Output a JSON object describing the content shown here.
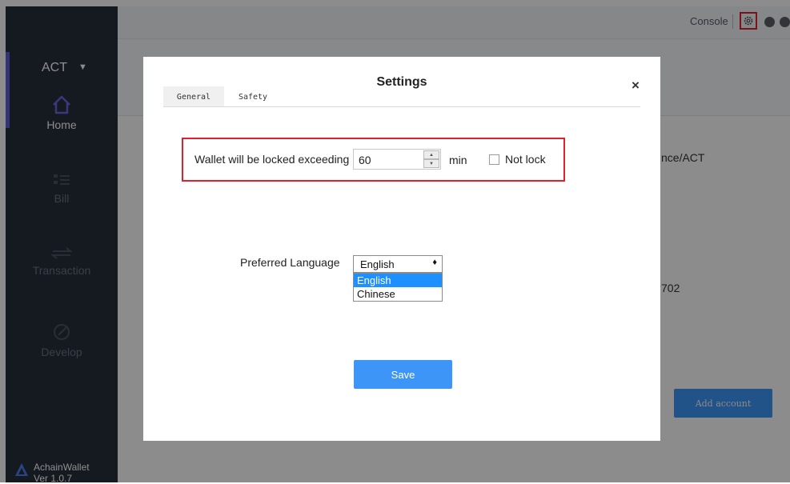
{
  "app": {
    "brand": "ACT",
    "brand_caret": "▼",
    "footer_name": "AchainWallet",
    "footer_version": "Ver 1.0.7"
  },
  "sidebar": {
    "items": [
      {
        "label": "Home",
        "icon": "home-icon",
        "active": true
      },
      {
        "label": "Bill",
        "icon": "bill-icon",
        "active": false
      },
      {
        "label": "Transaction",
        "icon": "transaction-icon",
        "active": false
      },
      {
        "label": "Develop",
        "icon": "develop-icon",
        "active": false
      }
    ]
  },
  "topbar": {
    "console_label": "Console",
    "icons": [
      "gear-icon",
      "minimize-icon",
      "close-window-icon"
    ]
  },
  "background": {
    "balance_text": "nce/ACT",
    "number_text": "702",
    "add_account_label": "Add account"
  },
  "settings": {
    "title": "Settings",
    "close_glyph": "×",
    "tabs": [
      {
        "label": "General",
        "active": true
      },
      {
        "label": "Safety",
        "active": false
      }
    ],
    "lock": {
      "label": "Wallet will be locked exceeding",
      "value": "60",
      "unit": "min",
      "not_lock_label": "Not lock",
      "not_lock_checked": false
    },
    "language": {
      "label": "Preferred Language",
      "selected": "English",
      "options": [
        "English",
        "Chinese"
      ]
    },
    "save_label": "Save"
  },
  "colors": {
    "sidebar_bg": "#27313d",
    "accent": "#5b5fd6",
    "primary_button": "#3d95f7",
    "highlight_border": "#e0202f",
    "selected_option": "#1e90ff"
  }
}
